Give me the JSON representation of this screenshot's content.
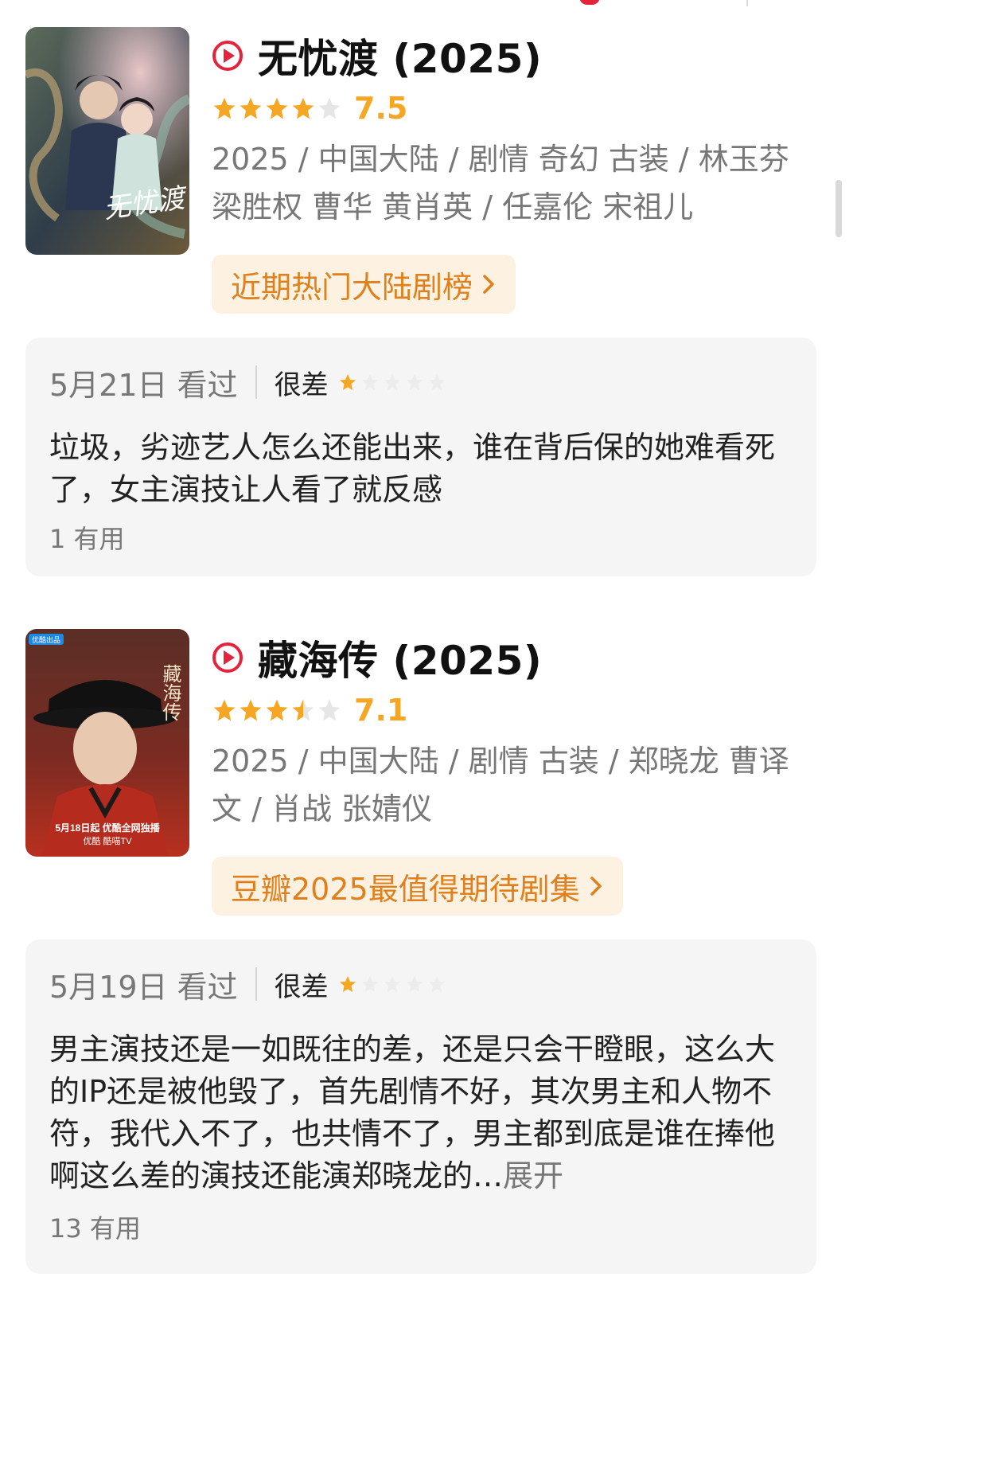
{
  "movies": [
    {
      "title": "无忧渡 (2025)",
      "rating": 4,
      "score": "7.5",
      "meta": "2025 / 中国大陆 / 剧情 奇幻 古装 / 林玉芬 梁胜权 曹华 黄肖英 / 任嘉伦 宋祖儿",
      "rank_label": "近期热门大陆剧榜",
      "poster_text": "无忧渡",
      "review": {
        "date": "5月21日 看过",
        "level": "很差",
        "stars": 1,
        "text": "垃圾，劣迹艺人怎么还能出来，谁在背后保的她难看死了，女主演技让人看了就反感",
        "useful": "1 有用"
      }
    },
    {
      "title": "藏海传 (2025)",
      "rating": 3.5,
      "score": "7.1",
      "meta": "2025 / 中国大陆 / 剧情 古装 / 郑晓龙 曹译文 / 肖战 张婧仪",
      "rank_label": "豆瓣2025最值得期待剧集",
      "poster_badge": "优酷出品",
      "poster_title": "藏海传",
      "poster_caption": "5月18日起 优酷全网独播",
      "poster_logos": "优酷  酷喵TV",
      "review": {
        "date": "5月19日 看过",
        "level": "很差",
        "stars": 1,
        "text": "男主演技还是一如既往的差，还是只会干瞪眼，这么大的IP还是被他毁了，首先剧情不好，其次男主和人物不符，我代入不了，也共情不了，男主都到底是谁在捧他啊这么差的演技还能演郑晓龙的…",
        "more": "展开",
        "useful": "13 有用"
      }
    }
  ],
  "colors": {
    "accent_red": "#e4243d",
    "star_gold": "#f5a623",
    "rank_bg": "#fdf2e2",
    "rank_text": "#e0801c",
    "review_bg": "#f5f5f5"
  }
}
